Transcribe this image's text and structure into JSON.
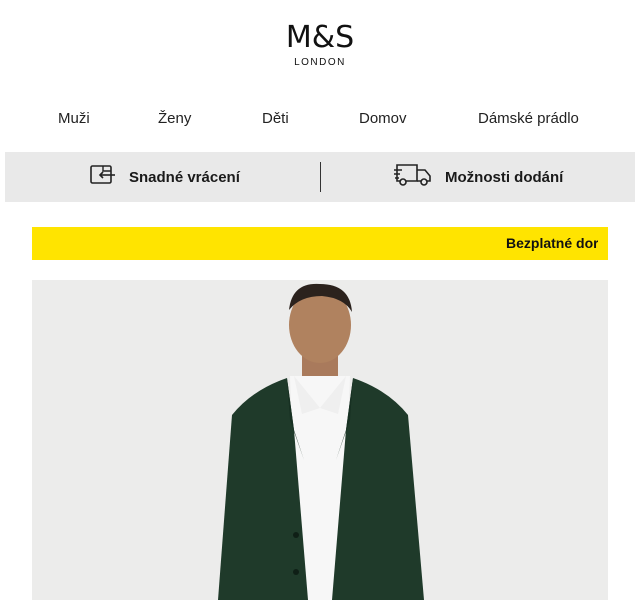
{
  "brand": {
    "logo_text": "M&S",
    "logo_sub": "LONDON"
  },
  "nav": {
    "items": [
      {
        "label": "Muži"
      },
      {
        "label": "Ženy"
      },
      {
        "label": "Děti"
      },
      {
        "label": "Domov"
      },
      {
        "label": "Dámské prádlo"
      }
    ]
  },
  "services": {
    "returns_label": "Snadné vrácení",
    "returns_icon": "return-box-icon",
    "delivery_label": "Možnosti dodání",
    "delivery_icon": "delivery-truck-icon"
  },
  "promo": {
    "text": "Bezplatné dor"
  },
  "hero": {
    "image_icon": "man-in-green-suit-photo"
  },
  "colors": {
    "promo_bg": "#ffe400",
    "service_bg": "#e9e9e9",
    "hero_bg": "#ececeb",
    "suit": "#1f3a2a"
  }
}
